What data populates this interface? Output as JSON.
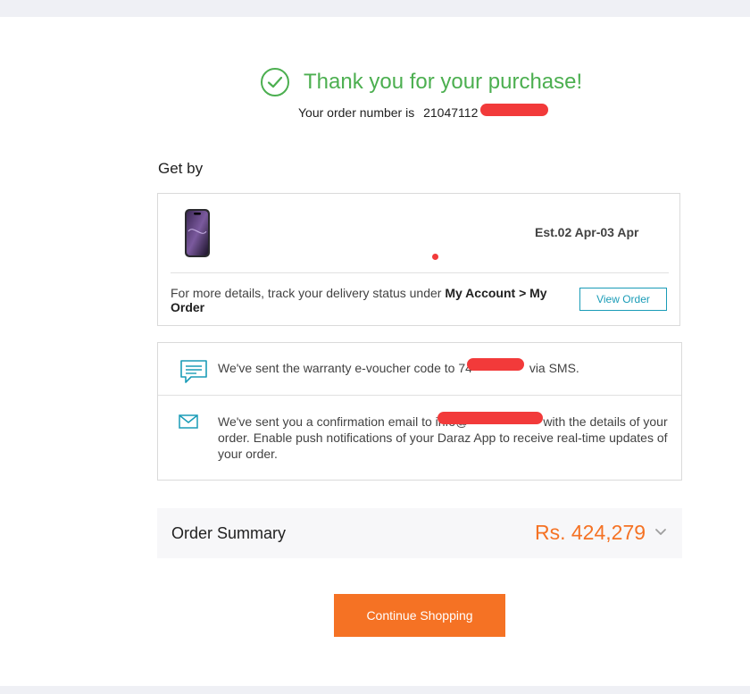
{
  "header": {
    "title": "Thank you for your purchase!",
    "order_label": "Your order number is",
    "order_number": "21047112"
  },
  "delivery": {
    "heading": "Get by",
    "estimate": "Est.02 Apr-03 Apr",
    "track_prefix": "For more details, track your delivery status under",
    "track_path": "My Account > My Order",
    "view_order_label": "View Order"
  },
  "notifications": {
    "sms_prefix": "We've sent the warranty e-voucher code to",
    "sms_phone_partial": "74",
    "sms_suffix": "via SMS.",
    "email_prefix": "We've sent you a confirmation email to",
    "email_partial": "info@",
    "email_suffix": "with the details of your order. Enable push notifications of your Daraz App to receive real-time updates of your order."
  },
  "summary": {
    "label": "Order Summary",
    "total": "Rs. 424,279"
  },
  "actions": {
    "continue_label": "Continue Shopping"
  },
  "colors": {
    "success": "#4caf50",
    "accent": "#f57224",
    "link": "#1a9cb7"
  },
  "icons": {
    "success": "check-circle-icon",
    "sms": "chat-bubble-icon",
    "email": "envelope-icon",
    "summary": "chevron-down-icon"
  }
}
